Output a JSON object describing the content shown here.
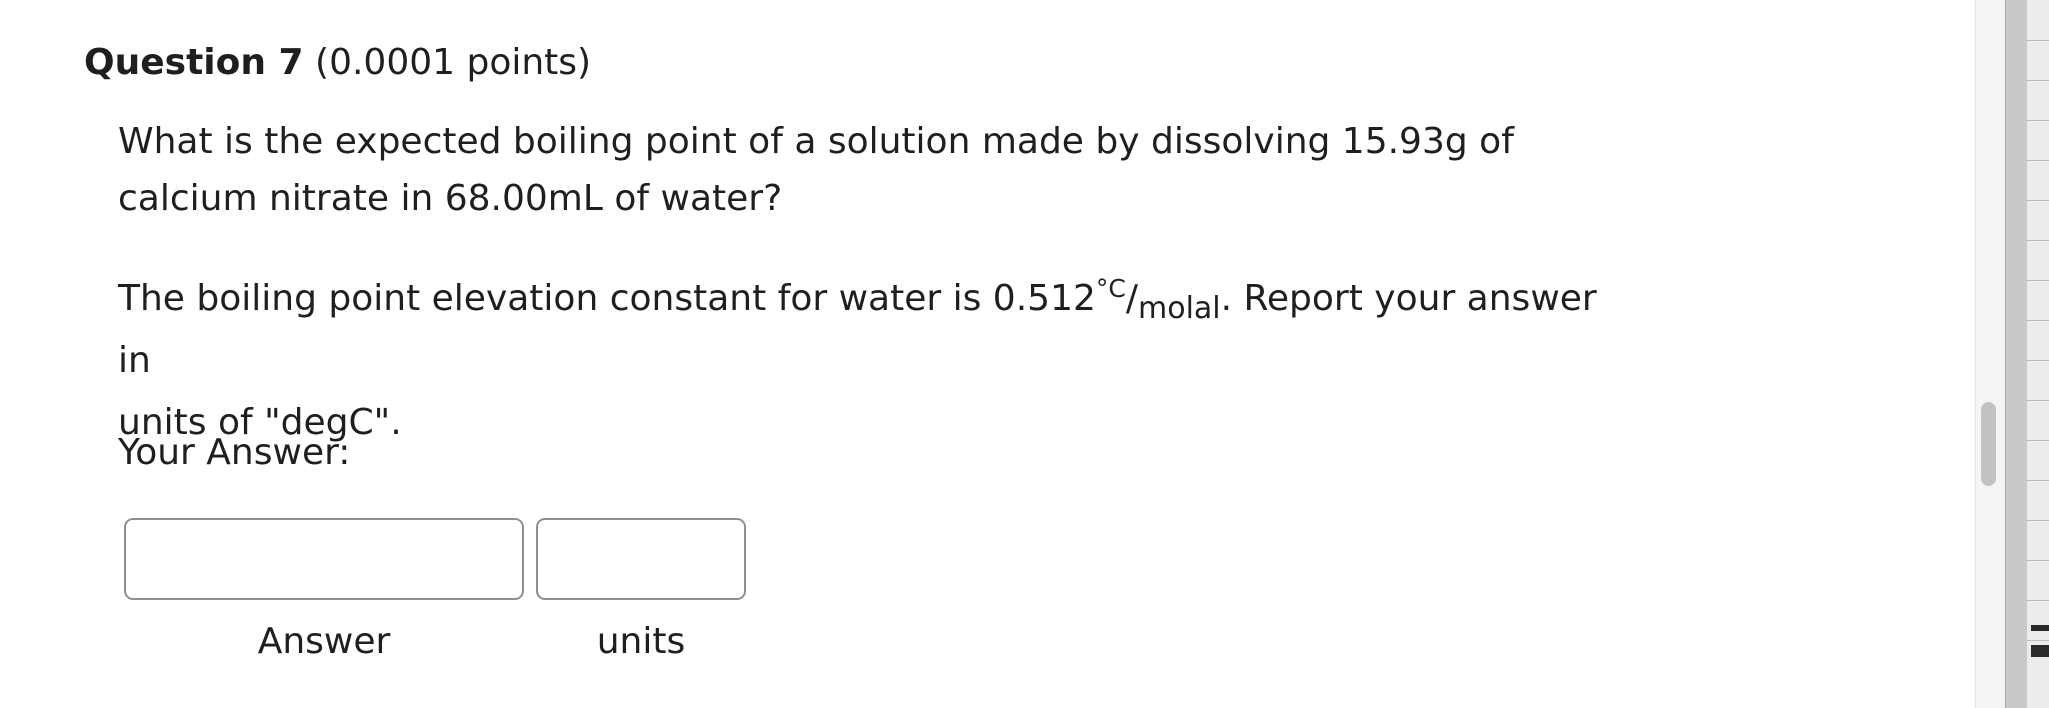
{
  "question": {
    "title": "Question 7",
    "points": "(0.0001 points)",
    "body_line1": "What is the expected boiling point of a solution made by dissolving 15.93g of",
    "body_line2": "calcium nitrate in 68.00mL of water?",
    "para2_prefix": "The boiling point elevation constant for water is 0.512",
    "unit_numerator": "°C",
    "unit_slash": "/",
    "unit_denominator": "molal",
    "para2_suffix": ". Report your answer in",
    "para2_line2": "units of \"degC\".",
    "your_answer_label": "Your Answer:"
  },
  "inputs": {
    "answer": {
      "label": "Answer",
      "value": ""
    },
    "units": {
      "label": "units",
      "value": ""
    }
  },
  "colors": {
    "text": "#1f1f1f",
    "input_border": "#8d8f92",
    "scroll_thumb": "#c2c2c2"
  }
}
